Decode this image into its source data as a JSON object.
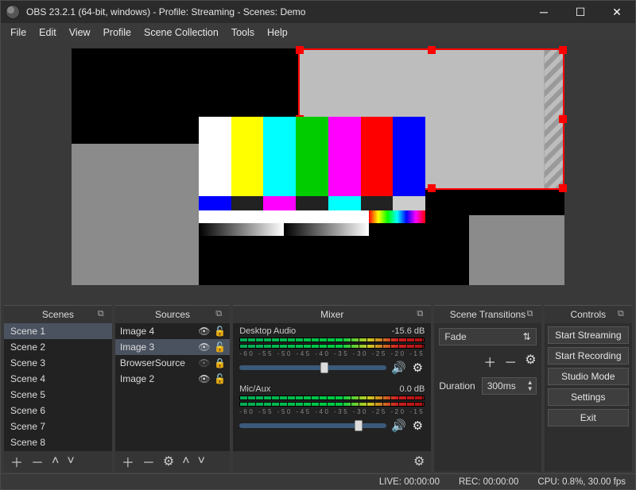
{
  "window": {
    "title": "OBS 23.2.1 (64-bit, windows) - Profile: Streaming - Scenes: Demo"
  },
  "menu": [
    "File",
    "Edit",
    "View",
    "Profile",
    "Scene Collection",
    "Tools",
    "Help"
  ],
  "panels": {
    "scenes": {
      "title": "Scenes",
      "items": [
        "Scene 1",
        "Scene 2",
        "Scene 3",
        "Scene 4",
        "Scene 5",
        "Scene 6",
        "Scene 7",
        "Scene 8"
      ],
      "selected": 0
    },
    "sources": {
      "title": "Sources",
      "items": [
        {
          "name": "Image 4",
          "visible": true,
          "locked": false
        },
        {
          "name": "Image 3",
          "visible": true,
          "locked": false,
          "selected": true
        },
        {
          "name": "BrowserSource",
          "visible": false,
          "locked": true
        },
        {
          "name": "Image 2",
          "visible": true,
          "locked": false
        }
      ]
    },
    "mixer": {
      "title": "Mixer",
      "channels": [
        {
          "name": "Desktop Audio",
          "db": "-15.6 dB",
          "slider": 0.55
        },
        {
          "name": "Mic/Aux",
          "db": "0.0 dB",
          "slider": 0.78
        }
      ],
      "tick_labels": "-60  -55  -50  -45  -40  -35  -30  -25  -20  -15"
    },
    "transitions": {
      "title": "Scene Transitions",
      "current": "Fade",
      "duration_label": "Duration",
      "duration": "300ms"
    },
    "controls": {
      "title": "Controls",
      "buttons": [
        "Start Streaming",
        "Start Recording",
        "Studio Mode",
        "Settings",
        "Exit"
      ]
    }
  },
  "status": {
    "live": "LIVE: 00:00:00",
    "rec": "REC: 00:00:00",
    "cpu": "CPU: 0.8%, 30.00 fps"
  }
}
